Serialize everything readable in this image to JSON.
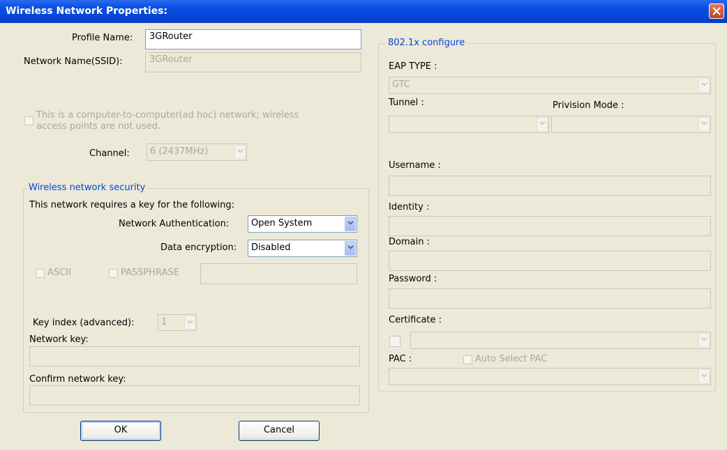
{
  "window": {
    "title": "Wireless Network Properties:"
  },
  "profile": {
    "label": "Profile Name:",
    "value": "3GRouter"
  },
  "ssid": {
    "label": "Network Name(SSID):",
    "value": "3GRouter"
  },
  "adhoc": {
    "label_line1": "This is a computer-to-computer(ad hoc) network; wireless",
    "label_line2": "access points are not used."
  },
  "channel": {
    "label": "Channel:",
    "value": "6  (2437MHz)"
  },
  "security": {
    "group_title": "Wireless network security",
    "requires_text": "This network requires a key for the following:",
    "auth_label": "Network Authentication:",
    "auth_value": "Open System",
    "enc_label": "Data encryption:",
    "enc_value": "Disabled",
    "ascii_label": "ASCII",
    "passphrase_label": "PASSPHRASE",
    "key_index_label": "Key index (advanced):",
    "key_index_value": "1",
    "network_key_label": "Network key:",
    "confirm_key_label": "Confirm network key:"
  },
  "eap": {
    "group_title": "802.1x configure",
    "eap_type_label": "EAP TYPE :",
    "eap_type_value": "GTC",
    "tunnel_label": "Tunnel :",
    "provision_label": "Privision Mode :",
    "username_label": "Username :",
    "identity_label": "Identity :",
    "domain_label": "Domain :",
    "password_label": "Password :",
    "certificate_label": "Certificate :",
    "pac_label": "PAC :",
    "auto_pac_label": "Auto Select PAC"
  },
  "buttons": {
    "ok": "OK",
    "cancel": "Cancel"
  }
}
